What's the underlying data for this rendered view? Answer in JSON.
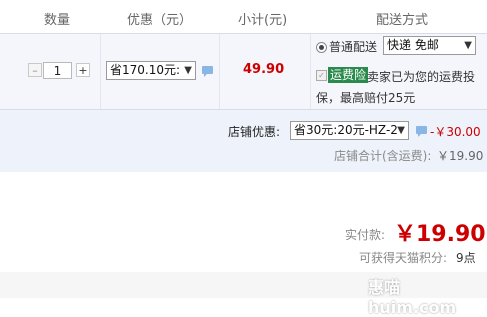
{
  "header": {
    "qty": "数量",
    "discount": "优惠（元）",
    "subtotal": "小计(元)",
    "shipping": "配送方式"
  },
  "item": {
    "qty_minus": "–",
    "qty_value": "1",
    "qty_plus": "+",
    "discount_select": "省170.10元:",
    "subtotal": "49.90",
    "shipping_option": "普通配送",
    "shipping_select": "快递 免邮",
    "insurance_tag": "运费险",
    "insurance_desc_line1": "卖家已为您的运费投",
    "insurance_desc_line2": "保，最高赔付25元"
  },
  "store": {
    "discount_label": "店铺优惠:",
    "discount_select": "省30元:20元-HZ-2",
    "discount_amount": "-￥30.00",
    "total_label": "店铺合计(含运费):",
    "total_value": "￥19.90"
  },
  "summary": {
    "pay_label": "实付款:",
    "pay_value": "￥19.90",
    "points_label": "可获得天猫积分:",
    "points_value": "9点"
  },
  "watermark": "惠喵 huim.com",
  "colors": {
    "price_red": "#cc0000",
    "tag_green": "#2a8a4c",
    "row_bg": "#f4f6fb",
    "store_bg": "#eef3fb"
  }
}
